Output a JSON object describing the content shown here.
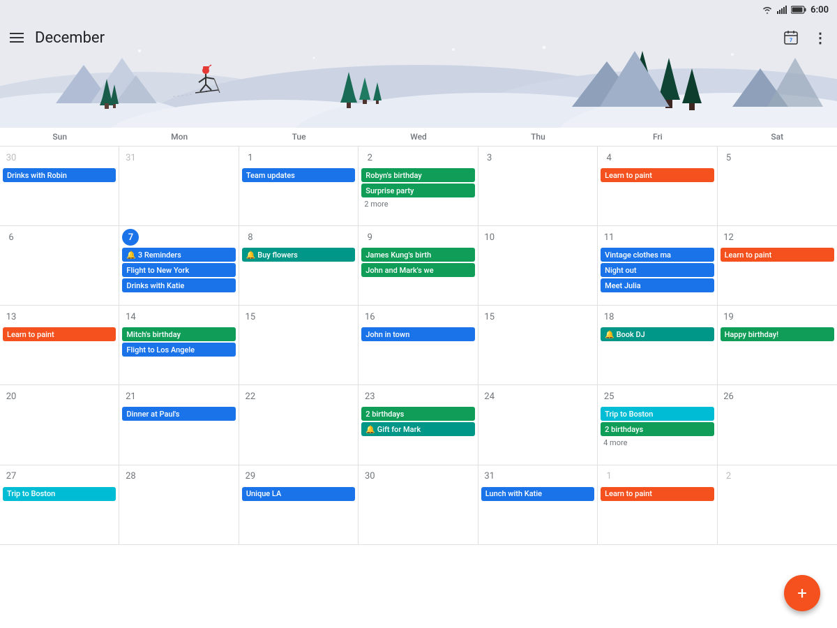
{
  "statusBar": {
    "time": "6:00",
    "icons": [
      "wifi",
      "signal",
      "battery"
    ]
  },
  "header": {
    "menuLabel": "menu",
    "title": "December",
    "calendarIcon": "📅",
    "moreIcon": "⋮",
    "dayNumber": "7"
  },
  "dayHeaders": [
    "Sun",
    "Mon",
    "Tue",
    "Wed",
    "Thu",
    "Fri",
    "Sat"
  ],
  "weeks": [
    {
      "days": [
        {
          "num": "30",
          "otherMonth": true,
          "events": [
            {
              "label": "Drinks with Robin",
              "color": "blue"
            }
          ]
        },
        {
          "num": "31",
          "otherMonth": true,
          "events": []
        },
        {
          "num": "1",
          "events": [
            {
              "label": "Team updates",
              "color": "blue"
            }
          ]
        },
        {
          "num": "2",
          "events": [
            {
              "label": "Robyn's birthday",
              "color": "green"
            },
            {
              "label": "Surprise party",
              "color": "green"
            }
          ],
          "more": "2 more"
        },
        {
          "num": "3",
          "events": []
        },
        {
          "num": "4",
          "events": [
            {
              "label": "Learn to paint",
              "color": "orange",
              "icon": "🚩"
            }
          ]
        },
        {
          "num": "5",
          "events": []
        }
      ]
    },
    {
      "days": [
        {
          "num": "6",
          "events": []
        },
        {
          "num": "7",
          "today": true,
          "events": [
            {
              "label": "🔔 3 Reminders",
              "color": "blue"
            },
            {
              "label": "Flight to New York",
              "color": "blue"
            },
            {
              "label": "Drinks with Katie",
              "color": "blue"
            }
          ]
        },
        {
          "num": "8",
          "events": [
            {
              "label": "🔔 Buy flowers",
              "color": "teal"
            }
          ]
        },
        {
          "num": "9",
          "events": [
            {
              "label": "James Kung's birth",
              "color": "green"
            },
            {
              "label": "John and Mark's we",
              "color": "green"
            }
          ]
        },
        {
          "num": "10",
          "events": []
        },
        {
          "num": "11",
          "events": [
            {
              "label": "Vintage clothes ma",
              "color": "blue"
            },
            {
              "label": "Night out",
              "color": "blue"
            },
            {
              "label": "Meet Julia",
              "color": "blue"
            }
          ]
        },
        {
          "num": "12",
          "events": [
            {
              "label": "Learn to paint",
              "color": "orange",
              "icon": "🚩"
            }
          ]
        }
      ]
    },
    {
      "days": [
        {
          "num": "13",
          "events": [
            {
              "label": "Learn to paint",
              "color": "orange",
              "icon": "🚩"
            }
          ]
        },
        {
          "num": "14",
          "events": [
            {
              "label": "Mitch's birthday",
              "color": "green"
            },
            {
              "label": "Flight to Los Angele",
              "color": "blue"
            }
          ]
        },
        {
          "num": "15",
          "events": []
        },
        {
          "num": "16",
          "events": [
            {
              "label": "John in town",
              "color": "blue"
            }
          ]
        },
        {
          "num": "15",
          "events": []
        },
        {
          "num": "18",
          "events": [
            {
              "label": "🔔 Book DJ",
              "color": "teal"
            }
          ]
        },
        {
          "num": "19",
          "events": [
            {
              "label": "Happy birthday!",
              "color": "green"
            }
          ]
        }
      ]
    },
    {
      "days": [
        {
          "num": "20",
          "events": []
        },
        {
          "num": "21",
          "events": [
            {
              "label": "Dinner at Paul's",
              "color": "blue"
            }
          ]
        },
        {
          "num": "22",
          "events": []
        },
        {
          "num": "23",
          "events": [
            {
              "label": "2 birthdays",
              "color": "green"
            },
            {
              "label": "🔔 Gift for Mark",
              "color": "teal"
            }
          ]
        },
        {
          "num": "24",
          "events": []
        },
        {
          "num": "25",
          "events": [
            {
              "label": "Trip to Boston",
              "color": "cyan"
            },
            {
              "label": "2 birthdays",
              "color": "green"
            }
          ],
          "more": "4 more"
        },
        {
          "num": "26",
          "events": []
        }
      ]
    },
    {
      "days": [
        {
          "num": "27",
          "events": [
            {
              "label": "Trip to Boston",
              "color": "cyan"
            }
          ]
        },
        {
          "num": "28",
          "events": []
        },
        {
          "num": "29",
          "events": [
            {
              "label": "Unique LA",
              "color": "blue"
            }
          ]
        },
        {
          "num": "30",
          "events": []
        },
        {
          "num": "31",
          "events": [
            {
              "label": "Lunch with Katie",
              "color": "blue"
            }
          ]
        },
        {
          "num": "1",
          "otherMonth": true,
          "events": [
            {
              "label": "Learn to paint",
              "color": "orange",
              "icon": "🚩"
            }
          ]
        },
        {
          "num": "2",
          "otherMonth": true,
          "events": []
        }
      ]
    }
  ],
  "fab": {
    "label": "+"
  }
}
